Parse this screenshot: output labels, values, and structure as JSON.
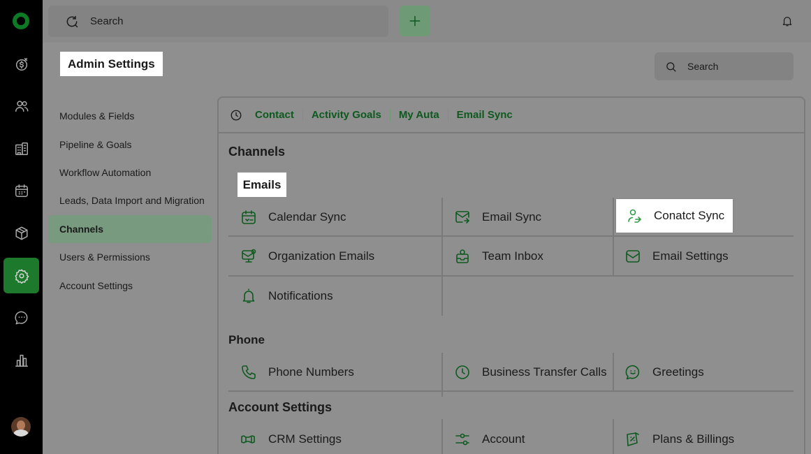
{
  "rail": {
    "items": [
      {
        "name": "deals-icon"
      },
      {
        "name": "contacts-icon"
      },
      {
        "name": "companies-icon"
      },
      {
        "name": "calendar-icon"
      },
      {
        "name": "products-icon"
      },
      {
        "name": "settings-icon",
        "active": true
      },
      {
        "name": "chat-icon"
      },
      {
        "name": "reports-icon"
      }
    ]
  },
  "topbar": {
    "search_label": "Search",
    "add_icon": "plus-icon",
    "notification_icon": "bell-icon"
  },
  "page": {
    "title": "Admin Settings",
    "search_label": "Search"
  },
  "settings_nav": {
    "items": [
      {
        "label": "Modules & Fields"
      },
      {
        "label": "Pipeline & Goals"
      },
      {
        "label": "Workflow Automation"
      },
      {
        "label": "Leads, Data Import and Migration"
      },
      {
        "label": "Channels",
        "active": true
      },
      {
        "label": "Users & Permissions"
      },
      {
        "label": "Account Settings"
      }
    ]
  },
  "recent_tabs": {
    "icon": "clock-icon",
    "items": [
      "Contact",
      "Activity Goals",
      "My Auta",
      "Email Sync"
    ]
  },
  "content": {
    "heading": "Channels",
    "emails": {
      "label": "Emails",
      "items": [
        {
          "label": "Calendar Sync",
          "icon": "calendar-sync-icon"
        },
        {
          "label": "Email Sync",
          "icon": "email-sync-icon"
        },
        {
          "label": "Conatct Sync",
          "icon": "contact-sync-icon",
          "highlighted": true
        },
        {
          "label": "Organization Emails",
          "icon": "organization-emails-icon"
        },
        {
          "label": "Team Inbox",
          "icon": "team-inbox-icon"
        },
        {
          "label": "Email Settings",
          "icon": "email-settings-icon"
        },
        {
          "label": "Notifications",
          "icon": "notifications-icon"
        }
      ]
    },
    "phone": {
      "label": "Phone",
      "items": [
        {
          "label": "Phone Numbers",
          "icon": "phone-icon"
        },
        {
          "label": "Business Transfer Calls",
          "icon": "clock-icon"
        },
        {
          "label": "Greetings",
          "icon": "greetings-icon"
        }
      ]
    },
    "account_settings": {
      "label": "Account Settings",
      "items": [
        {
          "label": "CRM Settings",
          "icon": "crm-settings-icon"
        },
        {
          "label": "Account",
          "icon": "account-icon"
        },
        {
          "label": "Plans & Billings",
          "icon": "billing-icon"
        }
      ]
    }
  },
  "colors": {
    "accent": "#0d5a1f",
    "rail_background": "#000000",
    "active_rail_item": "#1d7a2c",
    "active_nav_item": "#789a7e",
    "overlay_background": "#8f8f8f"
  }
}
